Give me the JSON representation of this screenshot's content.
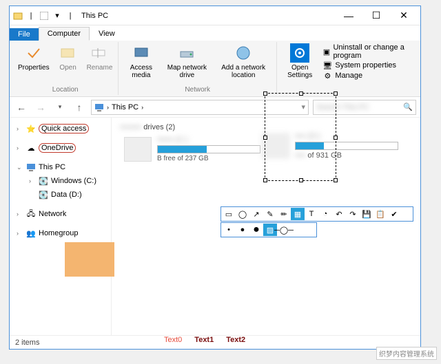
{
  "window": {
    "title": "This PC"
  },
  "tabs": {
    "file": "File",
    "computer": "Computer",
    "view": "View"
  },
  "ribbon": {
    "properties": "Properties",
    "open": "Open",
    "rename": "Rename",
    "access_media": "Access media",
    "map_drive": "Map network drive",
    "add_location": "Add a network location",
    "open_settings": "Open Settings",
    "uninstall": "Uninstall or change a program",
    "sysprops": "System properties",
    "manage": "Manage",
    "grp_location": "Location",
    "grp_network": "Network"
  },
  "address": {
    "path": "This PC",
    "search_placeholder": "Search This PC"
  },
  "tree": {
    "quick": "Quick access",
    "onedrive": "OneDrive",
    "thispc": "This PC",
    "winc": "Windows (C:)",
    "datad": "Data (D:)",
    "network": "Network",
    "homegroup": "Homegroup"
  },
  "content": {
    "heading_suffix": "drives (2)",
    "drives": [
      {
        "name": "Windows (C:)",
        "free": "B free of 237 GB",
        "fill": 48
      },
      {
        "name": "Data (D:)",
        "free": "of 931 GB",
        "fill": 28
      }
    ]
  },
  "status": {
    "items": "2 items"
  },
  "footer": {
    "t0": "Text0",
    "t1": "Text1",
    "t2": "Text2"
  },
  "watermark": "织梦内容管理系统"
}
